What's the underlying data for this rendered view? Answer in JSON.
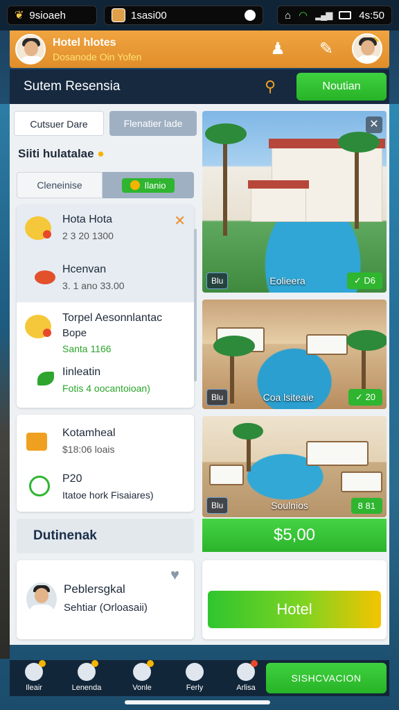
{
  "status_bar": {
    "left_text": "9sioaeh",
    "mid_text": "1sasi00",
    "right_text": "4s:50"
  },
  "header": {
    "title": "Hotel hlotes",
    "subtitle": "Dosanode Oin Yofen"
  },
  "title_bar": {
    "title": "Sutem Resensia",
    "notif_label": "Noutian"
  },
  "tabs": [
    {
      "label": "Cutsuer Dare",
      "active": true
    },
    {
      "label": "Flenatier lade",
      "active": false
    }
  ],
  "section_title": "Siiti hulatalae",
  "segment": {
    "left_label": "Cleneinise",
    "right_label": "Ilanio"
  },
  "list_items": [
    {
      "title": "Hota Hota",
      "sub": "2 3 20 1300",
      "icon": "emoji-face-icon"
    },
    {
      "title": "Hcenvan",
      "sub": "3. 1 ano 33.00",
      "icon": "crab-icon"
    },
    {
      "title": "Torpel Aesonnlantac",
      "title2": "Bope",
      "sub": "Santa 1166",
      "icon": "emoji-face-icon"
    },
    {
      "title": "Iinleatin",
      "sub": "Fotis 4 oocantoioan)",
      "icon": "leaf-icon"
    },
    {
      "title": "Kotamheal",
      "sub": "$18:06 loais",
      "icon": "box-icon"
    },
    {
      "title": "P20",
      "sub": "Itatoe hork Fisaiares)",
      "icon": "circle-leaf-icon"
    }
  ],
  "strip_label": "Dutinenak",
  "contact": {
    "name": "Peblersgkal",
    "sub": "Sehtiar (Orloasaii)"
  },
  "photos": [
    {
      "chip": "Blu",
      "label": "Eolieera",
      "price": "✓ D6"
    },
    {
      "chip": "Blu",
      "label": "Coa lsiteaie",
      "price": "✓ 20"
    },
    {
      "chip": "Blu",
      "label": "Soulnios",
      "price": "8 81"
    }
  ],
  "price_total": "$5,00",
  "hotel_button": "Hotel",
  "bottom_nav": [
    {
      "label": "Ileair"
    },
    {
      "label": "Lenenda"
    },
    {
      "label": "Vonle"
    },
    {
      "label": "Ferly"
    },
    {
      "label": "Arlisa"
    }
  ],
  "sync_button": "SISHCVACION",
  "colors": {
    "accent_orange": "#f0a440",
    "accent_green": "#2fb52f",
    "dark_navy": "#16293f"
  }
}
